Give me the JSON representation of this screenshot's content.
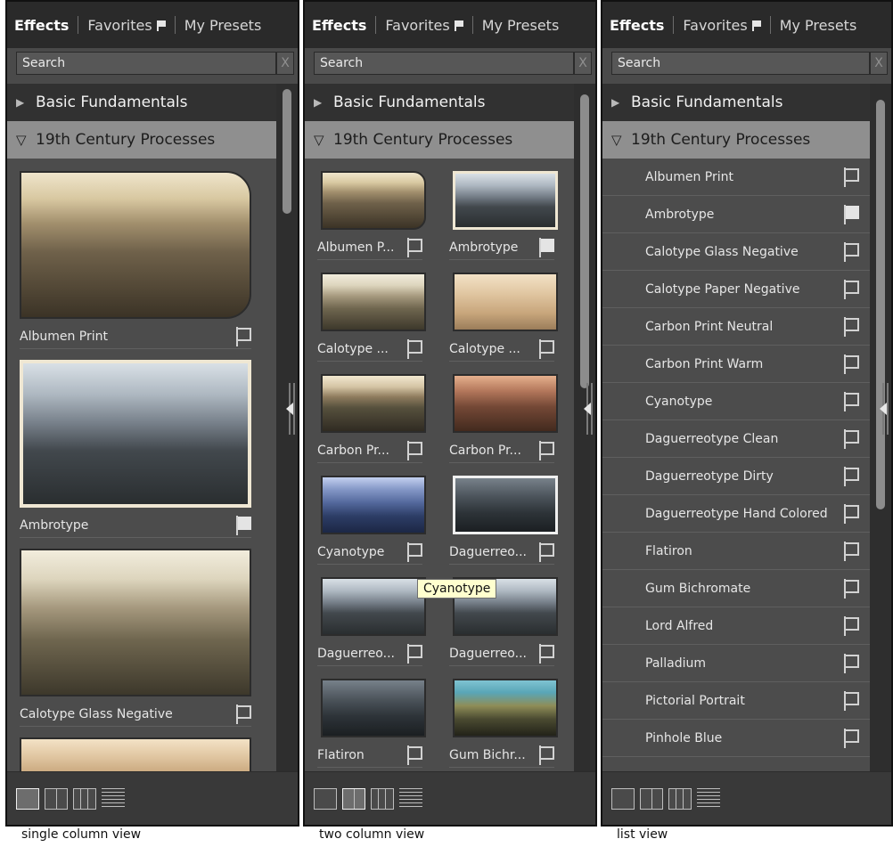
{
  "tabs": {
    "effects": "Effects",
    "favorites": "Favorites",
    "my_presets": "My Presets"
  },
  "search": {
    "placeholder": "Search",
    "clear": "X"
  },
  "categories": {
    "basic": "Basic Fundamentals",
    "nineteenth": "19th Century Processes"
  },
  "icons": {
    "collapsed_category": "triangle-right-icon",
    "expanded_category": "triangle-down-icon",
    "favorite": "flag-icon",
    "panel_handle": "chevron-left-icon"
  },
  "single_column": {
    "caption": "single column view",
    "items": [
      {
        "name": "Albumen Print",
        "favorite": false
      },
      {
        "name": "Ambrotype",
        "favorite": true
      },
      {
        "name": "Calotype Glass Negative",
        "favorite": false
      }
    ]
  },
  "two_column": {
    "caption": "two column view",
    "tooltip": "Cyanotype",
    "items": [
      {
        "name": "Albumen P...",
        "favorite": false
      },
      {
        "name": "Ambrotype",
        "favorite": true
      },
      {
        "name": "Calotype ...",
        "favorite": false
      },
      {
        "name": "Calotype ...",
        "favorite": false
      },
      {
        "name": "Carbon Pr...",
        "favorite": false
      },
      {
        "name": "Carbon Pr...",
        "favorite": false
      },
      {
        "name": "Cyanotype",
        "favorite": false
      },
      {
        "name": "Daguerreo...",
        "favorite": false
      },
      {
        "name": "Daguerreo...",
        "favorite": false
      },
      {
        "name": "Daguerreo...",
        "favorite": false
      },
      {
        "name": "Flatiron",
        "favorite": false
      },
      {
        "name": "Gum Bichr...",
        "favorite": false
      }
    ]
  },
  "list_view": {
    "caption": "list view",
    "items": [
      {
        "name": "Albumen Print",
        "favorite": false
      },
      {
        "name": "Ambrotype",
        "favorite": true
      },
      {
        "name": "Calotype Glass Negative",
        "favorite": false
      },
      {
        "name": "Calotype Paper Negative",
        "favorite": false
      },
      {
        "name": "Carbon Print Neutral",
        "favorite": false
      },
      {
        "name": "Carbon Print Warm",
        "favorite": false
      },
      {
        "name": "Cyanotype",
        "favorite": false
      },
      {
        "name": "Daguerreotype Clean",
        "favorite": false
      },
      {
        "name": "Daguerreotype Dirty",
        "favorite": false
      },
      {
        "name": "Daguerreotype Hand Colored",
        "favorite": false
      },
      {
        "name": "Flatiron",
        "favorite": false
      },
      {
        "name": "Gum Bichromate",
        "favorite": false
      },
      {
        "name": "Lord Alfred",
        "favorite": false
      },
      {
        "name": "Palladium",
        "favorite": false
      },
      {
        "name": "Pictorial Portrait",
        "favorite": false
      },
      {
        "name": "Pinhole Blue",
        "favorite": false
      }
    ]
  }
}
